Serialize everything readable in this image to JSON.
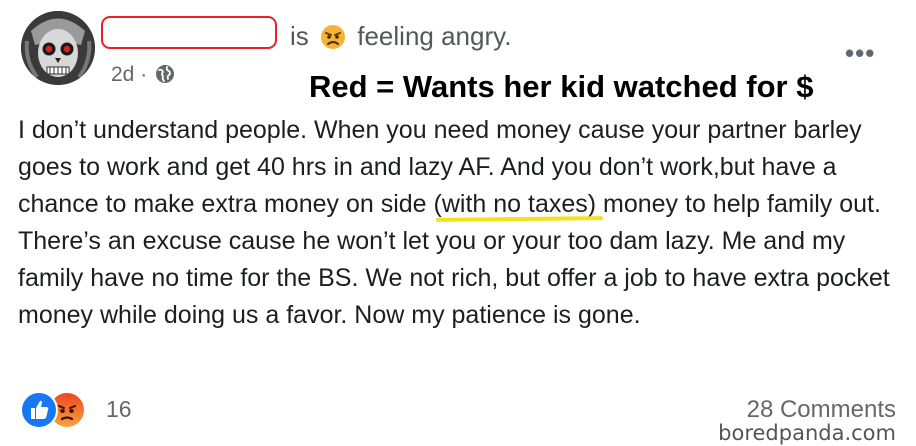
{
  "post": {
    "status_suffix": "is",
    "status_text": "feeling angry.",
    "time": "2d ·",
    "more_label": "•••",
    "annotation": "Red = Wants her kid watched for $",
    "body_before_underline": "I don’t understand people. When you need money cause your partner barley goes to work and get 40 hrs in and lazy AF. And you don’t work,but have a chance to make extra money on side ",
    "body_underlined": "(with no taxes)",
    "body_after_underline": " money to help family out. There’s an excuse cause he won’t let you or your too dam lazy. Me and my family have no time for the BS. We not rich, but offer a job to have extra pocket money while doing us a favor. Now my patience is gone."
  },
  "footer": {
    "reaction_count": "16",
    "comments": "28 Comments"
  },
  "watermark": "boredpanda.com",
  "icons": {
    "status_emoji": "angry-face-icon",
    "privacy": "globe-icon",
    "reaction_like": "like-icon",
    "reaction_angry": "angry-reaction-icon"
  },
  "colors": {
    "redact_border": "#e8202a",
    "underline": "#f2e21c",
    "like_blue": "#1877f2"
  }
}
